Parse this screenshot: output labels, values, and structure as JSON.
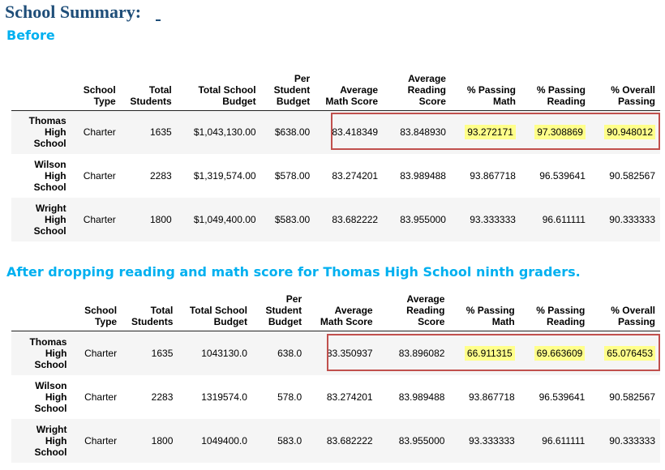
{
  "title": "School Summary:",
  "before": {
    "label": "Before",
    "columns": [
      "School Type",
      "Total Students",
      "Total School Budget",
      "Per Student Budget",
      "Average Math Score",
      "Average Reading Score",
      "% Passing Math",
      "% Passing Reading",
      "% Overall Passing"
    ],
    "rows": [
      {
        "school": "Thomas High School",
        "values": [
          "Charter",
          "1635",
          "$1,043,130.00",
          "$638.00",
          "83.418349",
          "83.848930",
          "93.272171",
          "97.308869",
          "90.948012"
        ]
      },
      {
        "school": "Wilson High School",
        "values": [
          "Charter",
          "2283",
          "$1,319,574.00",
          "$578.00",
          "83.274201",
          "83.989488",
          "93.867718",
          "96.539641",
          "90.582567"
        ]
      },
      {
        "school": "Wright High School",
        "values": [
          "Charter",
          "1800",
          "$1,049,400.00",
          "$583.00",
          "83.682222",
          "83.955000",
          "93.333333",
          "96.611111",
          "90.333333"
        ]
      }
    ]
  },
  "after": {
    "label": "After dropping reading and math score for Thomas High School ninth graders.",
    "columns": [
      "School Type",
      "Total Students",
      "Total School Budget",
      "Per Student Budget",
      "Average Math Score",
      "Average Reading Score",
      "% Passing Math",
      "% Passing Reading",
      "% Overall Passing"
    ],
    "rows": [
      {
        "school": "Thomas High School",
        "values": [
          "Charter",
          "1635",
          "1043130.0",
          "638.0",
          "83.350937",
          "83.896082",
          "66.911315",
          "69.663609",
          "65.076453"
        ]
      },
      {
        "school": "Wilson High School",
        "values": [
          "Charter",
          "2283",
          "1319574.0",
          "578.0",
          "83.274201",
          "83.989488",
          "93.867718",
          "96.539641",
          "90.582567"
        ]
      },
      {
        "school": "Wright High School",
        "values": [
          "Charter",
          "1800",
          "1049400.0",
          "583.0",
          "83.682222",
          "83.955000",
          "93.333333",
          "96.611111",
          "90.333333"
        ]
      }
    ]
  },
  "colors": {
    "title": "#1f4e79",
    "section_label": "#00b0f0",
    "highlight": "#ffff8a",
    "box_border": "#c0504d"
  }
}
